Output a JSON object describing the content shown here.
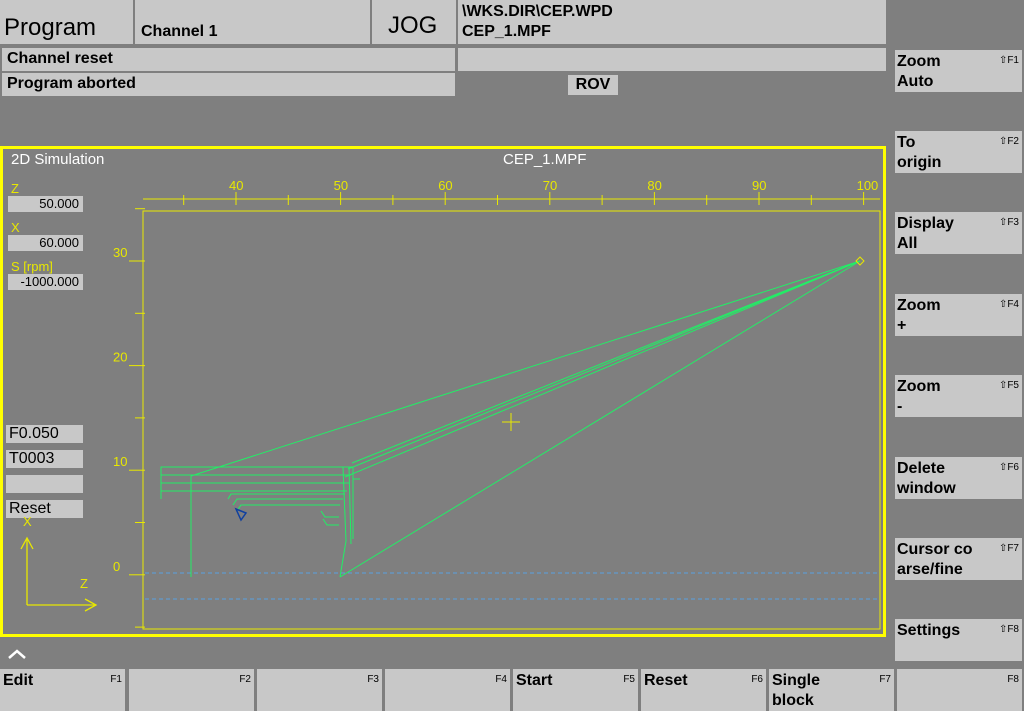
{
  "header": {
    "area": "Program",
    "channel": "Channel 1",
    "mode": "JOG",
    "path_line1": "\\WKS.DIR\\CEP.WPD",
    "path_line2": "CEP_1.MPF"
  },
  "status": {
    "channel_state": "Channel reset",
    "program_state": "Program aborted",
    "rov": "ROV"
  },
  "simulation": {
    "title": "2D Simulation",
    "file": "CEP_1.MPF",
    "z_label": "Z",
    "z_value": "50.000",
    "x_label": "X",
    "x_value": "60.000",
    "s_label": "S  [rpm]",
    "s_value": "-1000.000",
    "feed": "F0.050",
    "tool": "T0003",
    "extra": "",
    "reset_state": "Reset",
    "axis_x_label": "X",
    "axis_z_label": "Z",
    "top_ticks": [
      "40",
      "50",
      "60",
      "70",
      "80",
      "90",
      "100"
    ],
    "left_ticks": [
      "30",
      "20",
      "10",
      "0"
    ]
  },
  "vertical_softkeys": [
    {
      "line1": "Zoom",
      "line2": "Auto",
      "key": "⇧F1"
    },
    {
      "line1": "To",
      "line2": "origin",
      "key": "⇧F2"
    },
    {
      "line1": "Display",
      "line2": "All",
      "key": "⇧F3"
    },
    {
      "line1": "Zoom",
      "line2": "+",
      "key": "⇧F4"
    },
    {
      "line1": "Zoom",
      "line2": "-",
      "key": "⇧F5"
    },
    {
      "line1": "Delete",
      "line2": "window",
      "key": "⇧F6"
    },
    {
      "line1": "Cursor co",
      "line2": "arse/fine",
      "key": "⇧F7"
    },
    {
      "line1": "Settings",
      "line2": "",
      "key": "⇧F8"
    }
  ],
  "horizontal_softkeys": [
    {
      "line1": "Edit",
      "line2": "",
      "key": "F1"
    },
    {
      "line1": "",
      "line2": "",
      "key": "F2"
    },
    {
      "line1": "",
      "line2": "",
      "key": "F3"
    },
    {
      "line1": "",
      "line2": "",
      "key": "F4"
    },
    {
      "line1": "Start",
      "line2": "",
      "key": "F5"
    },
    {
      "line1": "Reset",
      "line2": "",
      "key": "F6"
    },
    {
      "line1": "Single",
      "line2": "block",
      "key": "F7"
    },
    {
      "line1": "",
      "line2": "",
      "key": "F8"
    }
  ],
  "colors": {
    "frame": "#ffff00",
    "toolpath": "#22ee66",
    "axis": "#e8e800",
    "panel": "#c8c8c8",
    "background": "#7f7f7f"
  }
}
